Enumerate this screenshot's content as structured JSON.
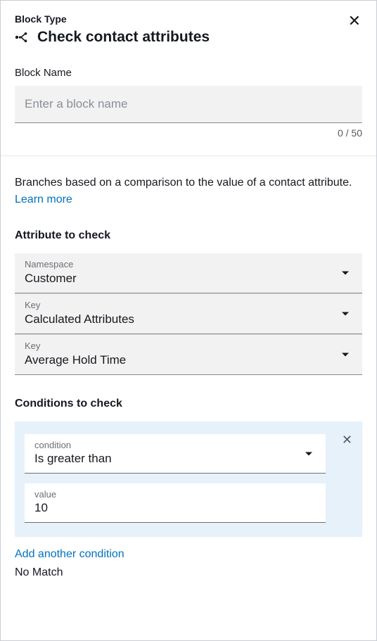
{
  "header": {
    "block_type_label": "Block Type",
    "title": "Check contact attributes"
  },
  "block_name": {
    "label": "Block Name",
    "placeholder": "Enter a block name",
    "value": "",
    "counter": "0 / 50"
  },
  "description": {
    "text": "Branches based on a comparison to the value of a contact attribute. ",
    "link_text": "Learn more"
  },
  "attribute_section": {
    "heading": "Attribute to check",
    "fields": [
      {
        "label": "Namespace",
        "value": "Customer"
      },
      {
        "label": "Key",
        "value": "Calculated Attributes"
      },
      {
        "label": "Key",
        "value": "Average Hold Time"
      }
    ]
  },
  "conditions_section": {
    "heading": "Conditions to check",
    "conditions": [
      {
        "condition_label": "condition",
        "condition_value": "Is greater than",
        "value_label": "value",
        "value": "10"
      }
    ],
    "add_label": "Add another condition",
    "no_match_label": "No Match"
  }
}
